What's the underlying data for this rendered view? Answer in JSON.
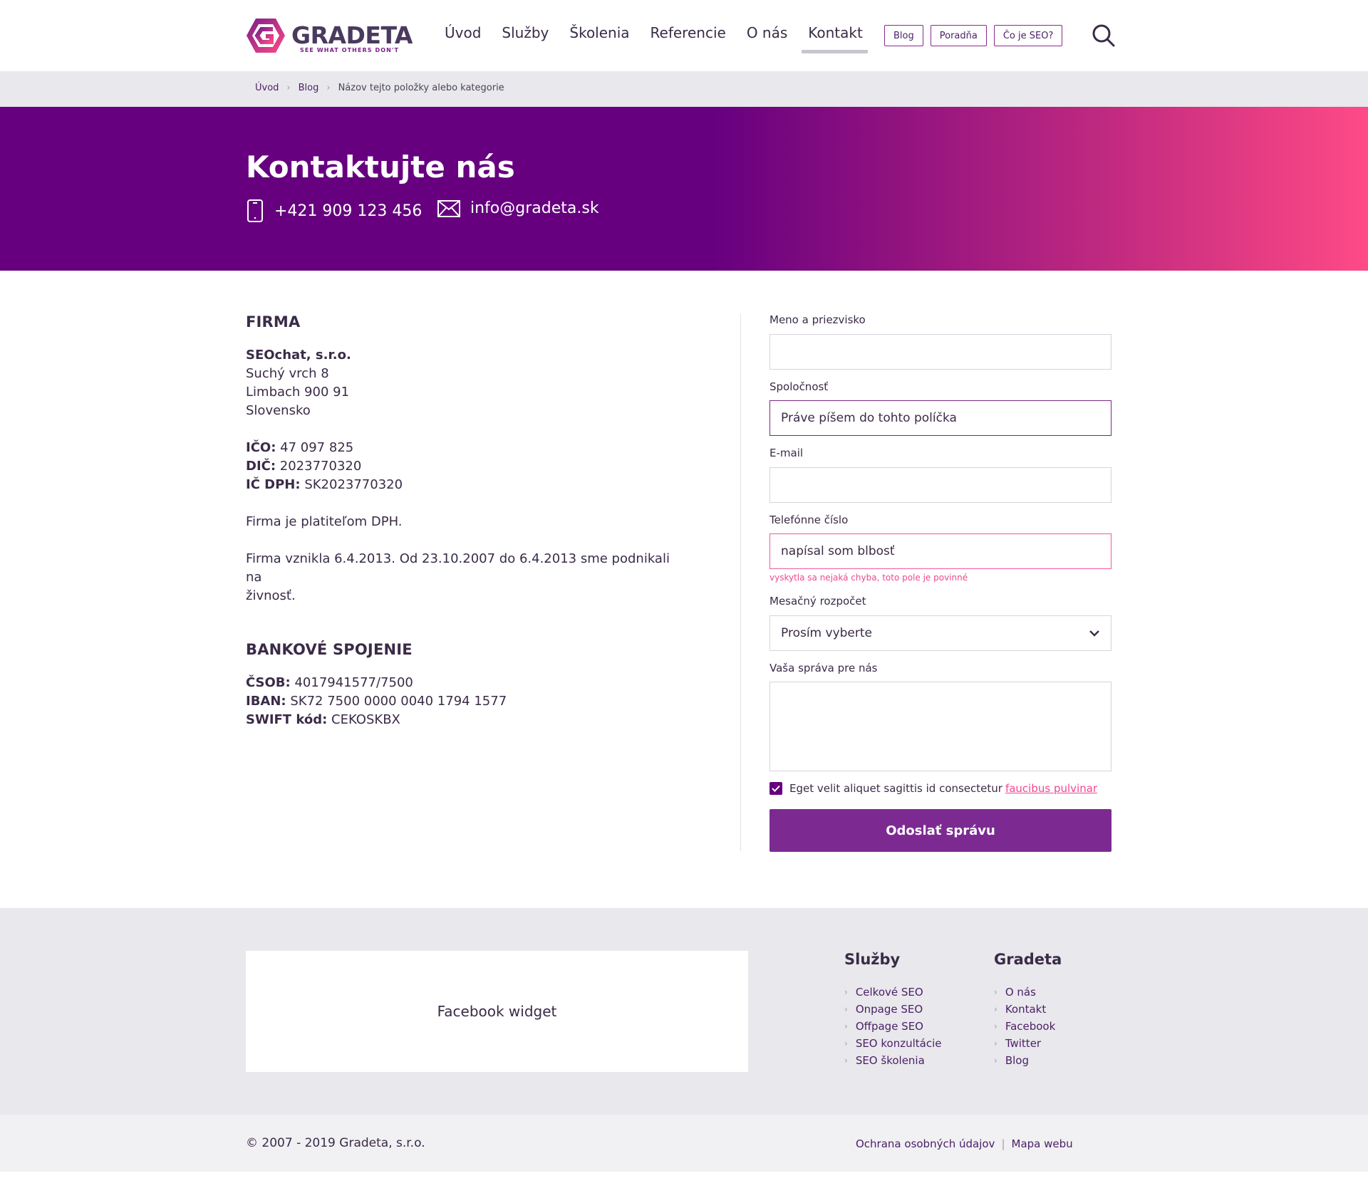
{
  "brand": {
    "name": "GRADETA",
    "tagline": "SEE WHAT OTHERS DON'T",
    "primary_color": "#66007f",
    "accent_color": "#ff4a86"
  },
  "nav": {
    "items": [
      "Úvod",
      "Služby",
      "Školenia",
      "Referencie",
      "O nás",
      "Kontakt"
    ],
    "active": "Kontakt",
    "pills": [
      "Blog",
      "Poradňa",
      "Čo je SEO?"
    ],
    "search_icon": "search-icon"
  },
  "breadcrumb": [
    "Úvod",
    "Blog",
    "Názov tejto položky alebo kategorie"
  ],
  "hero": {
    "title": "Kontaktujte nás",
    "phone": "+421 909 123 456",
    "email": "info@gradeta.sk"
  },
  "company": {
    "heading": "FIRMA",
    "name": "SEOchat, s.r.o.",
    "street": "Suchý vrch 8",
    "city": "Limbach 900 91",
    "country": "Slovensko",
    "ico_label": "IČO:",
    "ico": "47 097 825",
    "dic_label": "DIČ:",
    "dic": "2023770320",
    "icdph_label": "IČ DPH:",
    "icdph": "SK2023770320",
    "vat_note": "Firma je platiteľom DPH.",
    "history_1": "Firma vznikla 6.4.2013. Od 23.10.2007 do 6.4.2013 sme podnikali na",
    "history_2": "živnosť."
  },
  "bank": {
    "heading": "BANKOVÉ SPOJENIE",
    "csob_label": "ČSOB:",
    "csob": "4017941577/7500",
    "iban_label": "IBAN:",
    "iban": "SK72 7500 0000 0040 1794 1577",
    "swift_label": "SWIFT kód:",
    "swift": "CEKOSKBX"
  },
  "form": {
    "name_label": "Meno a priezvisko",
    "name_value": "",
    "company_label": "Spoločnosť",
    "company_value": "Práve píšem do tohto políčka",
    "email_label": "E-mail",
    "email_value": "",
    "phone_label": "Telefónne číslo",
    "phone_value": "napísal som blbosť",
    "phone_error": "vyskytla sa nejaká chyba, toto pole je povinné",
    "budget_label": "Mesačný rozpočet",
    "budget_value": "Prosím vyberte",
    "message_label": "Vaša správa pre nás",
    "message_value": "",
    "consent_text": "Eget velit aliquet sagittis id consectetur",
    "consent_link": "faucibus pulvinar",
    "consent_checked": true,
    "submit": "Odoslať správu"
  },
  "footer": {
    "widget": "Facebook widget",
    "services_title": "Služby",
    "services": [
      "Celkové SEO",
      "Onpage SEO",
      "Offpage SEO",
      "SEO konzultácie",
      "SEO školenia"
    ],
    "company_title": "Gradeta",
    "company_links": [
      "O nás",
      "Kontakt",
      "Facebook",
      "Twitter",
      "Blog"
    ],
    "copyright": "© 2007 - 2019 Gradeta, s.r.o.",
    "privacy": "Ochrana osobných údajov",
    "sitemap": "Mapa webu"
  }
}
